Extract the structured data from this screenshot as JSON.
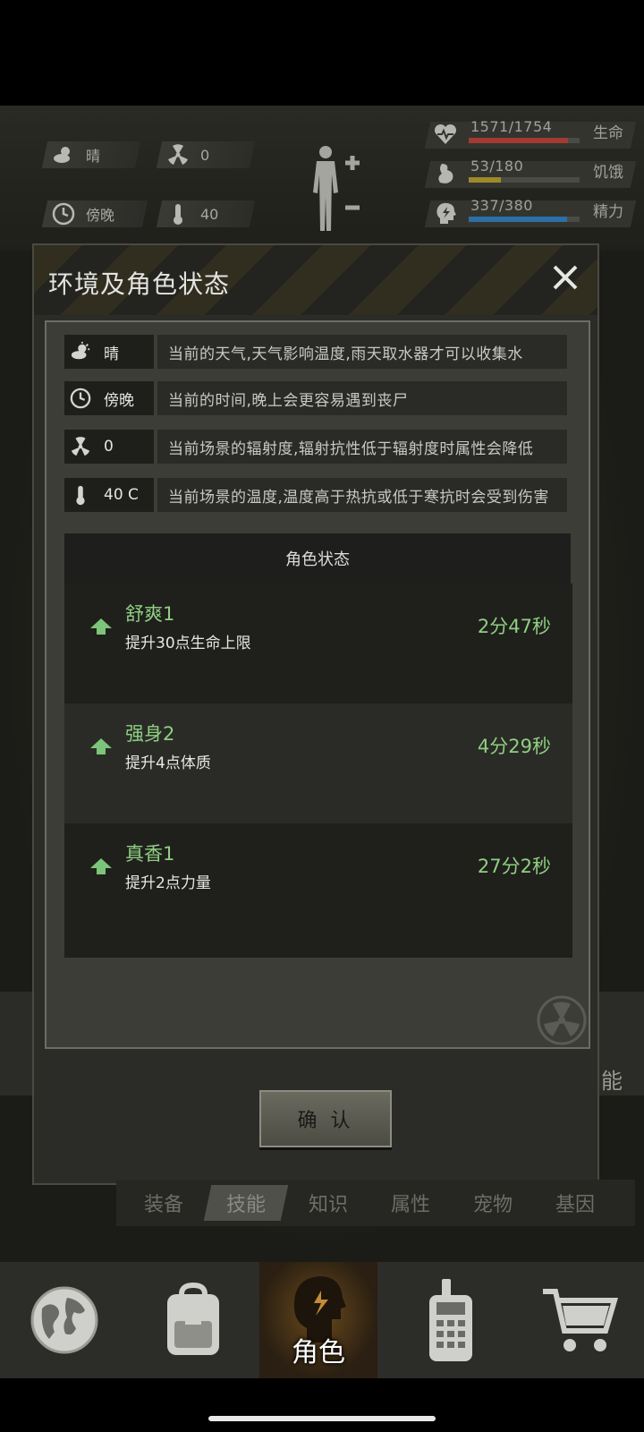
{
  "hud": {
    "weather": "晴",
    "radiation": "0",
    "time_of_day": "傍晚",
    "temperature": "40",
    "stats": [
      {
        "value": "1571/1754",
        "name": "生命",
        "fraction": 0.896,
        "color": "#a33a33"
      },
      {
        "value": "53/180",
        "name": "饥饿",
        "fraction": 0.29,
        "color": "#9c8a2a"
      },
      {
        "value": "337/380",
        "name": "精力",
        "fraction": 0.887,
        "color": "#2c6fa8"
      }
    ]
  },
  "dialog": {
    "title": "环境及角色状态",
    "info_rows": [
      {
        "key": "晴",
        "icon": "partly-cloudy-icon",
        "desc": "当前的天气,天气影响温度,雨天取水器才可以收集水"
      },
      {
        "key": "傍晚",
        "icon": "clock-icon",
        "desc": "当前的时间,晚上会更容易遇到丧尸"
      },
      {
        "key": "0",
        "icon": "radiation-icon",
        "desc": "当前场景的辐射度,辐射抗性低于辐射度时属性会降低"
      },
      {
        "key": "40 C",
        "icon": "thermometer-icon",
        "desc": "当前场景的温度,温度高于热抗或低于寒抗时会受到伤害"
      }
    ],
    "status_header": "角色状态",
    "statuses": [
      {
        "name": "舒爽1",
        "desc": "提升30点生命上限",
        "time": "2分47秒"
      },
      {
        "name": "强身2",
        "desc": "提升4点体质",
        "time": "4分29秒"
      },
      {
        "name": "真香1",
        "desc": "提升2点力量",
        "time": "27分2秒"
      }
    ],
    "confirm_label": "确 认"
  },
  "tabs": [
    "装备",
    "技能",
    "知识",
    "属性",
    "宠物",
    "基因"
  ],
  "active_tab": "技能",
  "side_glyph": "能",
  "bottom_nav": {
    "active_label": "角色",
    "items": [
      "globe-icon",
      "backpack-icon",
      "character-icon",
      "radio-icon",
      "cart-icon"
    ]
  }
}
